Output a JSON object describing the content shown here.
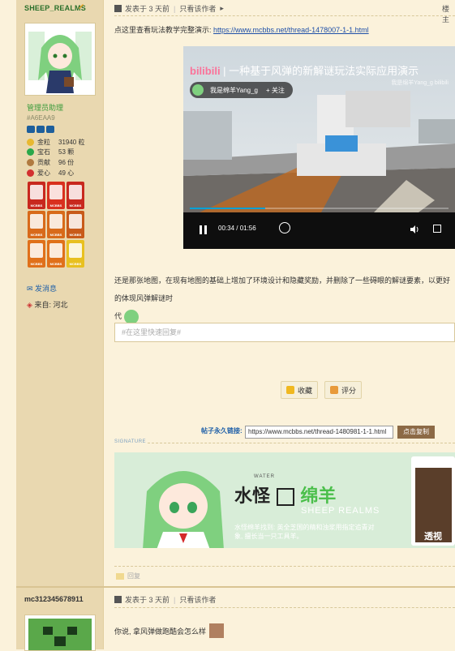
{
  "post1": {
    "username": "SHEEP_REALMS",
    "role": "管理员助理",
    "user_color": "#A6EAA9",
    "stats": [
      {
        "icon": "gold-icon",
        "label": "金粒",
        "value": "31940 粒",
        "color": "#e8b830"
      },
      {
        "icon": "gem-icon",
        "label": "宝石",
        "value": "53 颗",
        "color": "#2aa84a"
      },
      {
        "icon": "contribution-icon",
        "label": "贡献",
        "value": "96 份",
        "color": "#b07a40"
      },
      {
        "icon": "heart-icon",
        "label": "爱心",
        "value": "49 心",
        "color": "#d23030"
      }
    ],
    "medals": [
      {
        "color": "#c8281e",
        "label": "MCBBS"
      },
      {
        "color": "#d9301e",
        "label": "MCBBS"
      },
      {
        "color": "#c8281e",
        "label": "MCBBS"
      },
      {
        "color": "#d86a1a",
        "label": "MCBBS"
      },
      {
        "color": "#d86a1a",
        "label": "MCBBS"
      },
      {
        "color": "#c85a1a",
        "label": "MCBBS"
      },
      {
        "color": "#e0701a",
        "label": "MCBBS"
      },
      {
        "color": "#e0701a",
        "label": "MCBBS"
      },
      {
        "color": "#e8c020",
        "label": "MCBBS"
      }
    ],
    "send_message": "发消息",
    "from": "来自: 河北",
    "posted": "发表于 3 天前",
    "only_author": "只看该作者",
    "floor": "楼主",
    "intro_text": "点这里查看玩法教学完整演示:",
    "intro_link": "https://www.mcbbs.net/thread-1478007-1-1.html",
    "video": {
      "brand": "bilibili",
      "title": "一种基于风弹的新解谜玩法实际应用演示",
      "uploader": "我是绵羊Yang_g",
      "follow": "+ 关注",
      "watermark": "我是绵羊Yang_g bilibili",
      "time": "00:34 / 01:56",
      "progress": 0.29
    },
    "body_line1": "还是那张地图，在现有地图的基础上增加了环境设计和隐藏奖励，并删除了一些碍眼的解谜要素，以更好的体现风弹解谜时",
    "body_line2": "代",
    "reply_placeholder": "#在这里快速回复#",
    "favorite": "收藏",
    "rate": "评分",
    "permalink_label": "帖子永久链接:",
    "permalink_value": "https://www.mcbbs.net/thread-1480981-1-1.html",
    "copy_label": "点击复制",
    "signature_label": "SIGNATURE",
    "banner": {
      "water": "WATER",
      "title_a": "水怪",
      "title_b": "绵羊",
      "subtitle": "SHEEP REALMS",
      "desc": "水怪绵羊找到: 英全芝国的精和浊浆用指定追青对象, 擅长当一只工具羊。",
      "side_text": "透视"
    },
    "reply_link": "回复"
  },
  "post2": {
    "username": "mc312345678911",
    "posted": "发表于 3 天前",
    "only_author": "只看该作者",
    "message": "你说, 拿风弹做跑酷会怎么样"
  }
}
